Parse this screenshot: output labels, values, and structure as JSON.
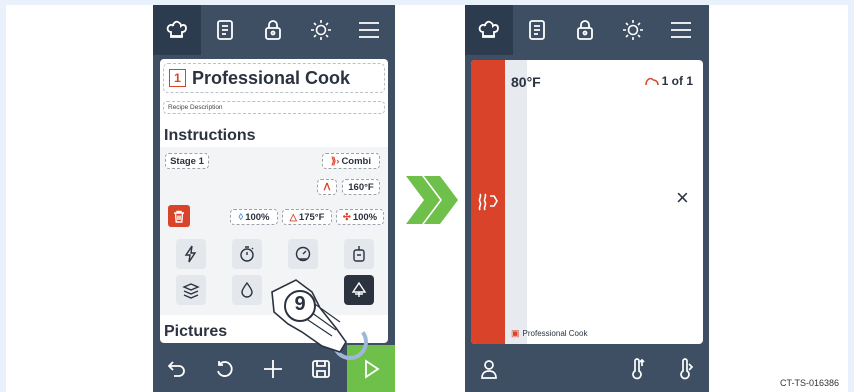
{
  "left_screen": {
    "recipe_number": "1",
    "recipe_title": "Professional Cook",
    "description_placeholder": "Recipe Description",
    "instructions_heading": "Instructions",
    "stage_label": "Stage 1",
    "mode_label": "Combi",
    "temperature": "160°F",
    "humidity": "100%",
    "core_temp": "175°F",
    "fan": "100%",
    "pictures_heading": "Pictures",
    "step_badge": "9"
  },
  "right_screen": {
    "temperature": "80°F",
    "count": "1 of 1",
    "close": "×",
    "recipe_name": "Professional Cook"
  },
  "footer": {
    "code": "CT-TS-016386"
  },
  "colors": {
    "accent_red": "#d9432a",
    "accent_green": "#6fc04b",
    "device_dark": "#3e4e63"
  }
}
